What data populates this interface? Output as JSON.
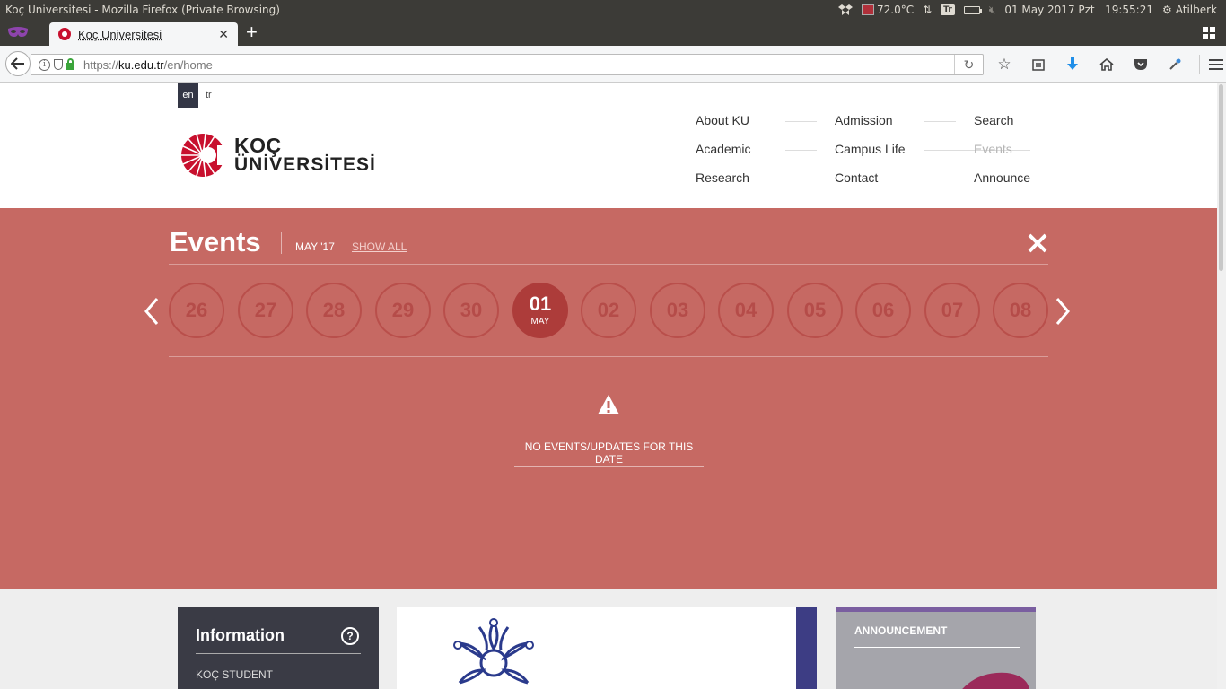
{
  "os_bar": {
    "window_title": "Koç Universitesi - Mozilla Firefox (Private Browsing)",
    "temperature": "72.0°C",
    "keyboard_layout": "Tr",
    "datetime": "01 May 2017 Pzt   19:55:21",
    "user": "Atilberk"
  },
  "browser": {
    "tab_title": "Koç Universitesi",
    "url_scheme": "https://",
    "url_host": "ku.edu.tr",
    "url_path": "/en/home",
    "icons": [
      "back-icon",
      "info-icon",
      "shield-icon",
      "lock-icon",
      "reload-icon",
      "bookmark-star-icon",
      "reading-list-icon",
      "download-icon",
      "home-icon",
      "pocket-icon",
      "eyedropper-icon",
      "menu-icon"
    ]
  },
  "header": {
    "lang_en": "en",
    "lang_tr": "tr",
    "logo_line1": "KOÇ",
    "logo_line2": "ÜNİVERSİTESİ",
    "nav": {
      "about": "About KU",
      "academic": "Academic",
      "research": "Research",
      "admission": "Admission",
      "campus_life": "Campus Life",
      "contact": "Contact",
      "search": "Search",
      "events": "Events",
      "announce": "Announce"
    }
  },
  "events": {
    "title": "Events",
    "month": "MAY '17",
    "show_all": "SHOW ALL",
    "days": [
      "26",
      "27",
      "28",
      "29",
      "30",
      "01",
      "02",
      "03",
      "04",
      "05",
      "06",
      "07",
      "08"
    ],
    "active_day": "01",
    "active_month": "MAY",
    "empty_message": "NO EVENTS/UPDATES FOR THIS DATE"
  },
  "lower": {
    "info_title": "Information",
    "info_help": "?",
    "info_link": "KOÇ STUDENT",
    "announcement_title": "ANNOUNCEMENT"
  },
  "colors": {
    "events_bg": "#c66963",
    "active_day": "#ad3c3a",
    "brand_red": "#c8102e",
    "info_box": "#3a3b45",
    "announcement_accent": "#7a5ea0"
  }
}
